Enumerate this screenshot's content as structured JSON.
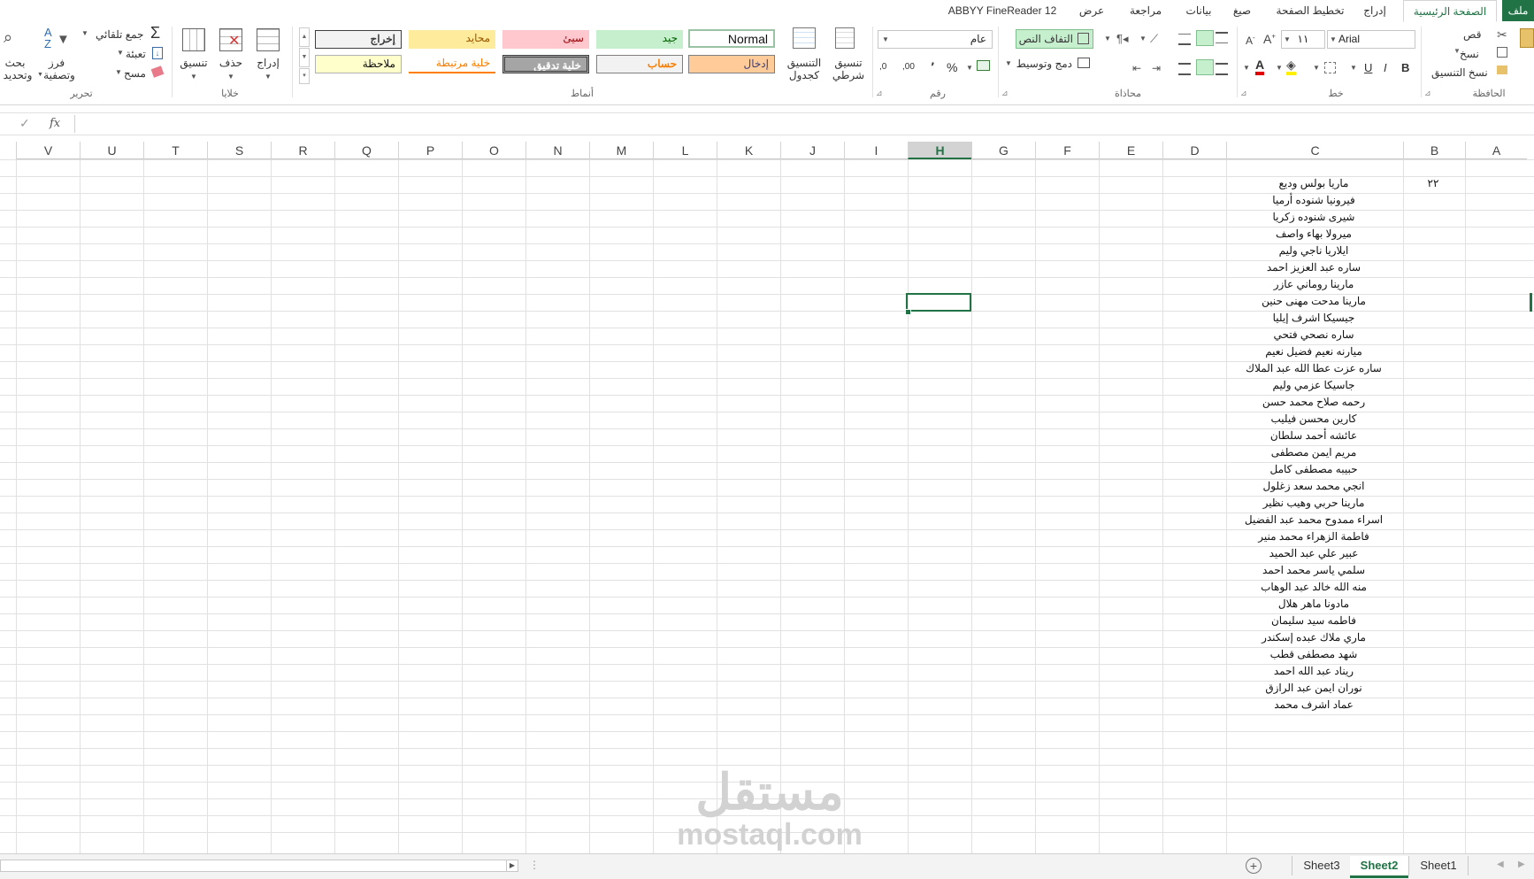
{
  "window": {
    "tabs": [
      "ملف",
      "الصفحة الرئيسية",
      "إدراج",
      "تخطيط الصفحة",
      "صيغ",
      "بيانات",
      "مراجعة",
      "عرض",
      "ABBYY FineReader 12"
    ]
  },
  "ribbon": {
    "clipboard": {
      "label": "الحافظة",
      "cut": "قص",
      "copy": "نسخ",
      "format_painter": "نسخ التنسيق"
    },
    "font": {
      "label": "خط",
      "name": "Arial",
      "size": "١١",
      "bold": "B",
      "italic": "I",
      "underline": "U"
    },
    "alignment": {
      "label": "محاذاة",
      "wrap_text": "التفاف النص",
      "merge_center": "دمج وتوسيط"
    },
    "number": {
      "label": "رقم",
      "format": "عام",
      "percent": "%",
      "comma": "٬",
      "inc_decimal": ",00",
      "dec_decimal": ",0"
    },
    "styles": {
      "label": "أنماط",
      "conditional": "تنسيق شرطي",
      "format_table_line1": "التنسيق",
      "format_table_line2": "كجدول",
      "cells": [
        {
          "text": "Normal"
        },
        {
          "text": "جيد"
        },
        {
          "text": "سيئ"
        },
        {
          "text": "محايد"
        },
        {
          "text": "إخراج"
        },
        {
          "text": "إدخال"
        },
        {
          "text": "حساب"
        },
        {
          "text": "خلية تدقيق"
        },
        {
          "text": "خلية مرتبطة"
        },
        {
          "text": "ملاحظة"
        }
      ]
    },
    "cells": {
      "label": "خلايا",
      "insert": "إدراج",
      "delete": "حذف",
      "format": "تنسيق"
    },
    "editing": {
      "label": "تحرير",
      "autosum": "جمع تلقائي",
      "fill": "تعبئة",
      "clear": "مسح",
      "sort_filter_1": "فرز",
      "sort_filter_2": "وتصفية",
      "find_select_1": "بحث",
      "find_select_2": "وتحديد"
    }
  },
  "formula_bar": {
    "fx": "fx",
    "value": ""
  },
  "grid": {
    "columns": [
      "A",
      "B",
      "C",
      "D",
      "E",
      "F",
      "G",
      "H",
      "I",
      "J",
      "K",
      "L",
      "M",
      "N",
      "O",
      "P",
      "Q",
      "R",
      "S",
      "T",
      "U",
      "V"
    ],
    "selected_column": "H",
    "b_value": "٢٢",
    "names": [
      "ماريا بولس وديع",
      "فيرونيا شنوده أرميا",
      "شيرى شنوده زكريا",
      "ميرولا بهاء واصف",
      "ايلاريا ناجي وليم",
      "ساره عبد العزيز احمد",
      "مارينا روماني عازر",
      "مارينا مدحت مهنى حنين",
      "جيسيكا اشرف إيليا",
      "ساره نصحي فتحي",
      "ميارنه نعيم فضيل نعيم",
      "ساره عزت عطا الله عبد الملاك",
      "جاسيكا عزمي وليم",
      "رحمه صلاح محمد حسن",
      "كارين محسن فيليب",
      "عائشه أحمد سلطان",
      "مريم ايمن مصطفى",
      "حبيبه مصطفى كامل",
      "انجي محمد سعد زغلول",
      "مارينا حربي وهيب نظير",
      "اسراء ممدوح محمد عبد الفضيل",
      "فاطمة الزهراء محمد منير",
      "عبير علي عبد الحميد",
      "سلمي ياسر محمد احمد",
      "منه الله خالد عبد الوهاب",
      "مادونا ماهر هلال",
      "فاطمه سيد سليمان",
      "ماري ملاك عبده إسكندر",
      "شهد مصطفى قطب",
      "ريناد عبد الله احمد",
      "نوران ايمن عبد الرازق",
      "عماد اشرف محمد"
    ]
  },
  "sheets": [
    "Sheet1",
    "Sheet2",
    "Sheet3"
  ],
  "active_sheet": "Sheet2",
  "watermark": {
    "arabic": "مستقل",
    "latin": "mostaql.com"
  },
  "colors": {
    "accent": "#217346",
    "selection": "#1f6b3e"
  }
}
